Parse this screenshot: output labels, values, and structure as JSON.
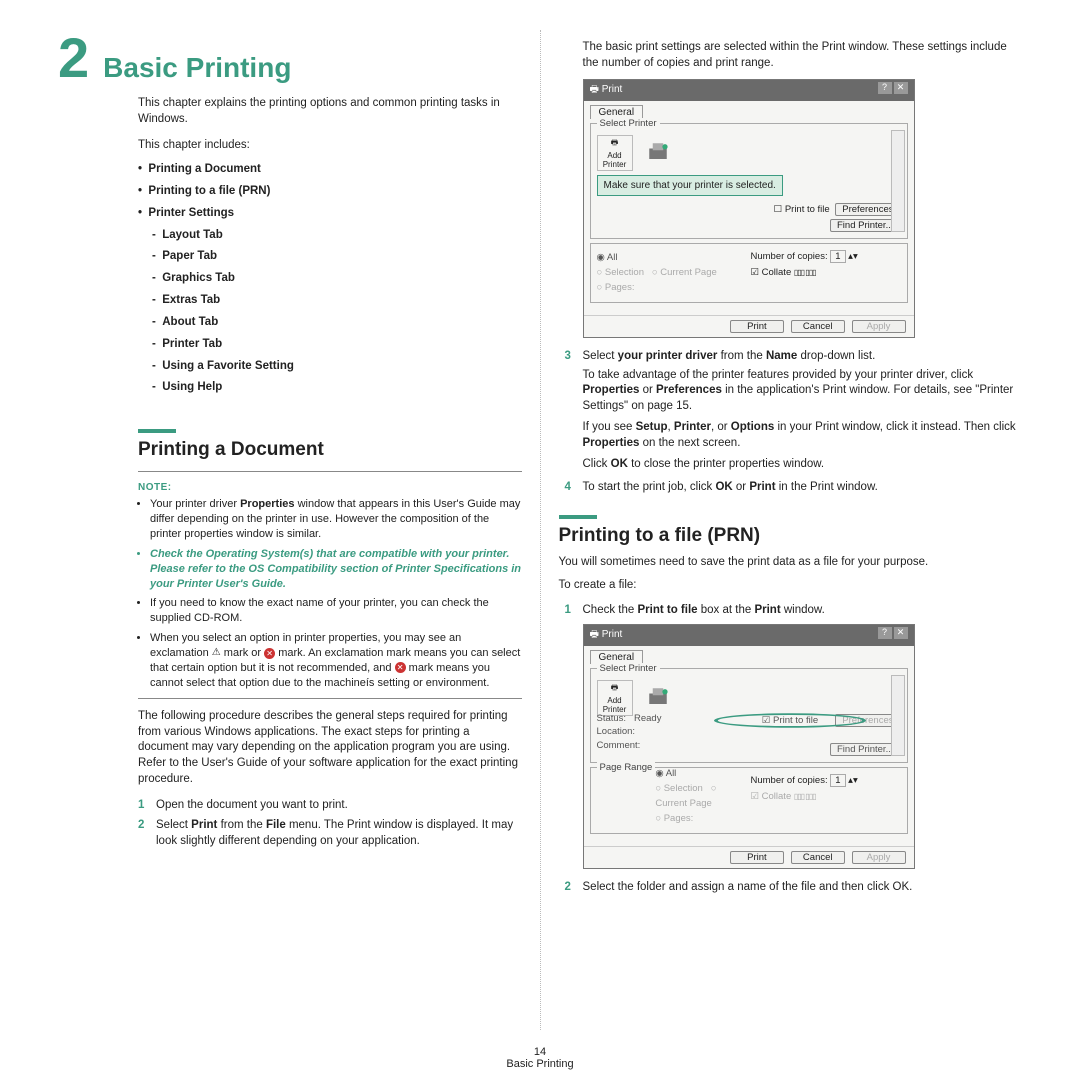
{
  "chapter": {
    "number": "2",
    "title": "Basic Printing"
  },
  "intro": "This chapter explains the printing options and common printing tasks in Windows.",
  "includes_label": "This chapter includes:",
  "toc": {
    "i1": "Printing a Document",
    "i2": "Printing to a file (PRN)",
    "i3": "Printer Settings",
    "s1": "Layout Tab",
    "s2": "Paper Tab",
    "s3": "Graphics Tab",
    "s4": "Extras Tab",
    "s5": "About Tab",
    "s6": "Printer Tab",
    "s7": "Using a Favorite Setting",
    "s8": "Using Help"
  },
  "sectionA": "Printing a Document",
  "note_label": "NOTE:",
  "notes": {
    "n1a": "Your printer driver ",
    "n1b": "Properties",
    "n1c": " window that appears in this User's Guide may differ depending on the printer in use. However the composition of the printer properties window is similar.",
    "n2": "Check the Operating System(s) that are compatible with your printer. Please refer to the OS Compatibility section of Printer Specifications in your Printer User's Guide.",
    "n3": "If you need to know the exact name of your printer, you can check the supplied CD-ROM.",
    "n4a": "When you select an option in printer properties, you may see an exclamation ",
    "n4b": " mark or ",
    "n4c": " mark. An exclamation mark means you can select that certain option but it is not recommended, and ",
    "n4d": " mark means you cannot select that option due to the machineís setting or environment."
  },
  "paraA": "The following procedure describes the general steps required for printing from various Windows applications. The exact steps for printing a document may vary depending on the application program you are using. Refer to the User's Guide of your software application for the exact printing procedure.",
  "stepsA": {
    "s1": "Open the document you want to print.",
    "s2a": "Select ",
    "s2b": "Print",
    "s2c": " from the ",
    "s2d": "File",
    "s2e": " menu. The Print window is displayed. It may look slightly different depending on your application."
  },
  "right": {
    "top": "The basic print settings are selected within the Print window. These settings include the number of copies and print range.",
    "callout": "Make sure that your printer is selected.",
    "s3a": "Select ",
    "s3b": "your printer driver",
    "s3c": " from the ",
    "s3d": "Name",
    "s3e": " drop-down list.",
    "p1a": "To take advantage of the printer features provided by your printer driver, click ",
    "p1b": "Properties",
    "p1c": " or ",
    "p1d": "Preferences",
    "p1e": " in the application's Print window. For details, see \"Printer Settings\" on page 15.",
    "p2a": "If you see ",
    "p2b": "Setup",
    "p2c": ", ",
    "p2d": "Printer",
    "p2e": ", or ",
    "p2f": "Options",
    "p2g": " in your Print window, click it instead. Then click ",
    "p2h": "Properties",
    "p2i": " on the next screen.",
    "p3a": "Click ",
    "p3b": "OK",
    "p3c": " to close the printer properties window.",
    "s4a": "To start the print job, click ",
    "s4b": "OK",
    "s4c": " or ",
    "s4d": "Print",
    "s4e": " in the Print window."
  },
  "sectionB": "Printing to a file (PRN)",
  "prn": {
    "p1": "You will sometimes need to save the print data as a file for your purpose.",
    "p2": "To create a file:",
    "s1a": "Check the ",
    "s1b": "Print to file",
    "s1c": " box at the ",
    "s1d": "Print",
    "s1e": " window.",
    "s2": "Select the folder and assign a name of the file and then click OK."
  },
  "dlg": {
    "title": "Print",
    "tab": "General",
    "fs1": "Select Printer",
    "add": "Add Printer",
    "status": "Status:",
    "ready": "Ready",
    "loc": "Location:",
    "com": "Comment:",
    "ptf": "Print to file",
    "pref": "Preferences",
    "find": "Find Printer...",
    "fs2": "Page Range",
    "all": "All",
    "sel": "Selection",
    "cur": "Current Page",
    "pages": "Pages:",
    "copies": "Number of copies:",
    "one": "1",
    "col": "Collate",
    "print": "Print",
    "cancel": "Cancel",
    "apply": "Apply"
  },
  "footer": {
    "page": "14",
    "label": "Basic Printing"
  }
}
